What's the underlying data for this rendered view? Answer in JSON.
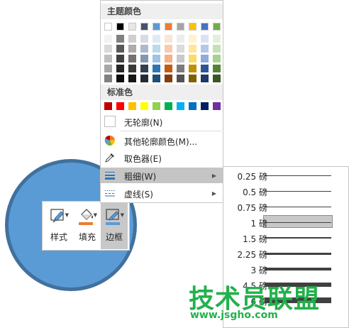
{
  "colors": {
    "shape_fill": "#5b9bd5",
    "shape_outline": "#41719c",
    "menu_highlight": "#c5c5c5",
    "watermark_green": "#22b14c"
  },
  "mini_toolbar": {
    "buttons": [
      {
        "label": "样式",
        "icon": "shape-style-icon"
      },
      {
        "label": "填充",
        "icon": "paint-bucket-icon",
        "swatch": "#ed7d31"
      },
      {
        "label": "边框",
        "icon": "pen-outline-icon",
        "swatch": "#5b9bd5",
        "active": true
      }
    ]
  },
  "dropdown": {
    "theme_title": "主题颜色",
    "theme_colors": [
      "#ffffff",
      "#000000",
      "#e7e6e6",
      "#44546a",
      "#5b9bd5",
      "#ed7d31",
      "#a5a5a5",
      "#ffc000",
      "#4472c4",
      "#70ad47"
    ],
    "theme_shades": [
      [
        "#f2f2f2",
        "#d9d9d9",
        "#bfbfbf",
        "#a6a6a6",
        "#808080"
      ],
      [
        "#808080",
        "#595959",
        "#404040",
        "#262626",
        "#0d0d0d"
      ],
      [
        "#d0cece",
        "#aeabab",
        "#757171",
        "#3a3838",
        "#171616"
      ],
      [
        "#d6dce5",
        "#adb9ca",
        "#8497b0",
        "#333f50",
        "#222a35"
      ],
      [
        "#deebf7",
        "#bdd7ee",
        "#9dc3e6",
        "#2e75b6",
        "#1f4e79"
      ],
      [
        "#fbe5d6",
        "#f8cbad",
        "#f4b183",
        "#c55a11",
        "#843c0c"
      ],
      [
        "#ededed",
        "#dbdbdb",
        "#c9c9c9",
        "#7b7b7b",
        "#525252"
      ],
      [
        "#fff2cc",
        "#ffe699",
        "#ffd966",
        "#bf9000",
        "#7f6000"
      ],
      [
        "#dae3f3",
        "#b4c7e7",
        "#8faadc",
        "#2f5597",
        "#1f3864"
      ],
      [
        "#e2f0d9",
        "#c5e0b4",
        "#a9d18e",
        "#548235",
        "#385723"
      ]
    ],
    "standard_title": "标准色",
    "standard_colors": [
      "#c00000",
      "#ff0000",
      "#ffc000",
      "#ffff00",
      "#92d050",
      "#00b050",
      "#00b0f0",
      "#0070c0",
      "#002060",
      "#7030a0"
    ],
    "items": {
      "no_outline": "无轮廓(N)",
      "more_colors": "其他轮廓颜色(M)...",
      "eyedropper": "取色器(E)",
      "weight": "粗细(W)",
      "dashes": "虚线(S)"
    }
  },
  "weights": [
    {
      "label": "0.25 磅",
      "pt": 0.25
    },
    {
      "label": "0.5 磅",
      "pt": 0.5
    },
    {
      "label": "0.75 磅",
      "pt": 0.75
    },
    {
      "label": "1 磅",
      "pt": 1,
      "selected": true
    },
    {
      "label": "1.5 磅",
      "pt": 1.5
    },
    {
      "label": "2.25 磅",
      "pt": 2.25
    },
    {
      "label": "3 磅",
      "pt": 3
    },
    {
      "label": "4.5 磅",
      "pt": 4.5
    },
    {
      "label": "6 磅",
      "pt": 6
    }
  ],
  "watermark": {
    "text": "技术员联盟",
    "url": "www.jsgho.com"
  }
}
